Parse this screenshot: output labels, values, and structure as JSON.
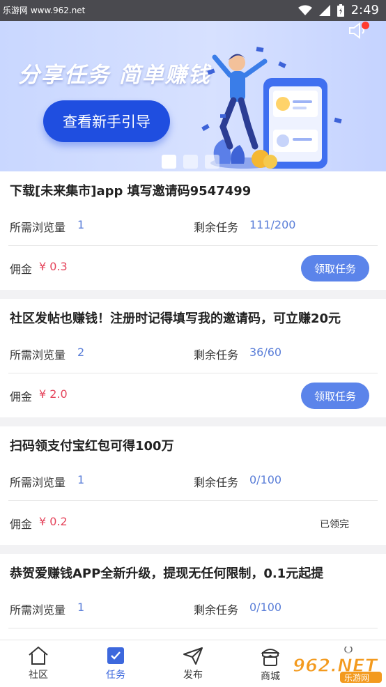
{
  "status_bar": {
    "watermark": "乐游网 www.962.net",
    "time": "2:49"
  },
  "banner": {
    "title": "分享任务 简单赚钱",
    "button_label": "查看新手引导",
    "active_slide": 1,
    "slide_count": 3
  },
  "tasks": [
    {
      "title": "下载[未来集市]app 填写邀请码9547499",
      "views_label": "所需浏览量",
      "views_value": "1",
      "remaining_label": "剩余任务",
      "remaining_value": "111/200",
      "price_label": "佣金",
      "price_value": "¥ 0.3",
      "action": "领取任务"
    },
    {
      "title": "社区发帖也赚钱！注册时记得填写我的邀请码，可立赚20元",
      "views_label": "所需浏览量",
      "views_value": "2",
      "remaining_label": "剩余任务",
      "remaining_value": "36/60",
      "price_label": "佣金",
      "price_value": "¥ 2.0",
      "action": "领取任务"
    },
    {
      "title": "扫码领支付宝红包可得100万",
      "views_label": "所需浏览量",
      "views_value": "1",
      "remaining_label": "剩余任务",
      "remaining_value": "0/100",
      "price_label": "佣金",
      "price_value": "¥ 0.2",
      "action": "已领完"
    },
    {
      "title": "恭贺爱赚钱APP全新升级，提现无任何限制，0.1元起提",
      "views_label": "所需浏览量",
      "views_value": "1",
      "remaining_label": "剩余任务",
      "remaining_value": "0/100"
    }
  ],
  "tabbar": {
    "items": [
      {
        "label": "社区",
        "icon": "home-icon"
      },
      {
        "label": "任务",
        "icon": "checkbox-icon",
        "active": true
      },
      {
        "label": "发布",
        "icon": "send-icon"
      },
      {
        "label": "商城",
        "icon": "store-icon"
      }
    ]
  },
  "brand_watermark": "962.NET",
  "brand_watermark_sub": "乐游网",
  "colors": {
    "accent": "#5b84ea",
    "price": "#e5455c",
    "banner_button": "#1f4ee0",
    "active_tab": "#3d68dd"
  }
}
